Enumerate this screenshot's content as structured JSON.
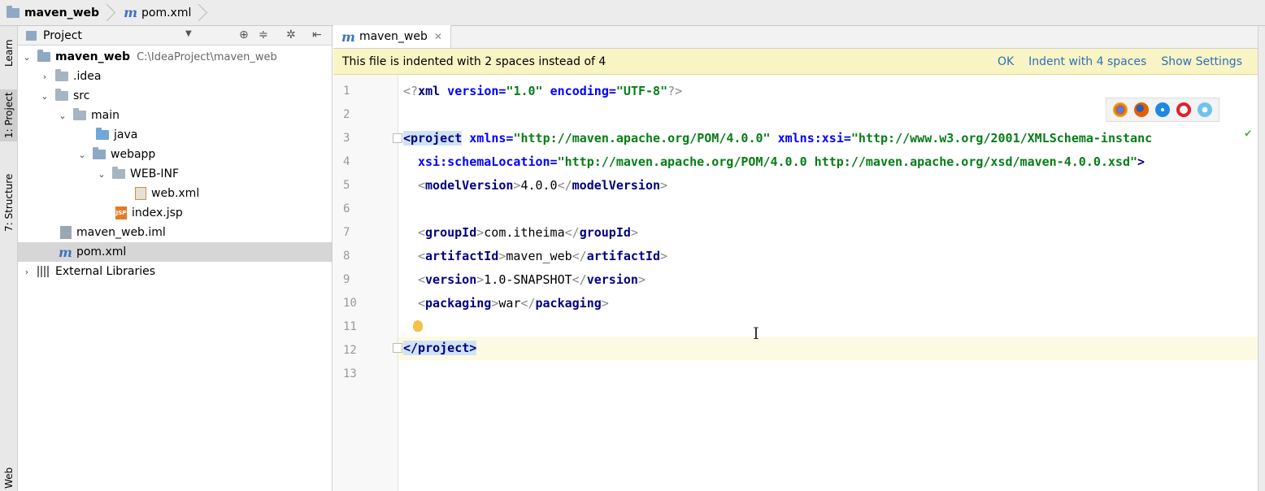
{
  "breadcrumb": {
    "project": "maven_web",
    "file": "pom.xml"
  },
  "left_strip": {
    "learn": "Learn",
    "project": "1: Project",
    "structure": "7: Structure",
    "web": "Web"
  },
  "project_panel": {
    "title": "Project",
    "tree": [
      {
        "label": "maven_web",
        "path": "C:\\IdeaProject\\maven_web"
      },
      {
        "label": ".idea"
      },
      {
        "label": "src"
      },
      {
        "label": "main"
      },
      {
        "label": "java"
      },
      {
        "label": "webapp"
      },
      {
        "label": "WEB-INF"
      },
      {
        "label": "web.xml"
      },
      {
        "label": "index.jsp"
      },
      {
        "label": "maven_web.iml"
      },
      {
        "label": "pom.xml"
      },
      {
        "label": "External Libraries"
      }
    ],
    "icon_text": {
      "jsp": "JSP"
    }
  },
  "editor": {
    "tab_label": "maven_web",
    "banner": {
      "message": "This file is indented with 2 spaces instead of 4",
      "ok": "OK",
      "indent": "Indent with 4 spaces",
      "settings": "Show Settings"
    },
    "line_numbers": [
      "1",
      "2",
      "3",
      "4",
      "5",
      "6",
      "7",
      "8",
      "9",
      "10",
      "11",
      "12",
      "13"
    ],
    "code": {
      "l1_open": "<?",
      "l1_tag": "xml",
      "l1_attr1": " version=",
      "l1_val1": "\"1.0\"",
      "l1_attr2": " encoding=",
      "l1_val2": "\"UTF-8\"",
      "l1_close": "?>",
      "l3_tag": "<project",
      "l3_attr1": " xmlns=",
      "l3_val1": "\"http://maven.apache.org/POM/4.0.0\"",
      "l3_attr2": " xmlns:xsi=",
      "l3_val2": "\"http://www.w3.org/2001/XMLSchema-instanc",
      "l4_attr": "xsi:schemaLocation=",
      "l4_val": "\"http://maven.apache.org/POM/4.0.0 http://maven.apache.org/xsd/maven-4.0.0.xsd\"",
      "l4_close": ">",
      "l5_tag": "modelVersion",
      "l5_val": "4.0.0",
      "l7_tag": "groupId",
      "l7_val": "com.itheima",
      "l8_tag": "artifactId",
      "l8_val": "maven_web",
      "l9_tag": "version",
      "l9_val": "1.0-SNAPSHOT",
      "l10_tag": "packaging",
      "l10_val": "war",
      "l12": "</project>"
    }
  },
  "colors": {
    "tag": "#00007f",
    "attribute": "#0000ff",
    "string": "#067d17",
    "banner_bg": "#f9f4c4",
    "link": "#2d6fbf"
  }
}
